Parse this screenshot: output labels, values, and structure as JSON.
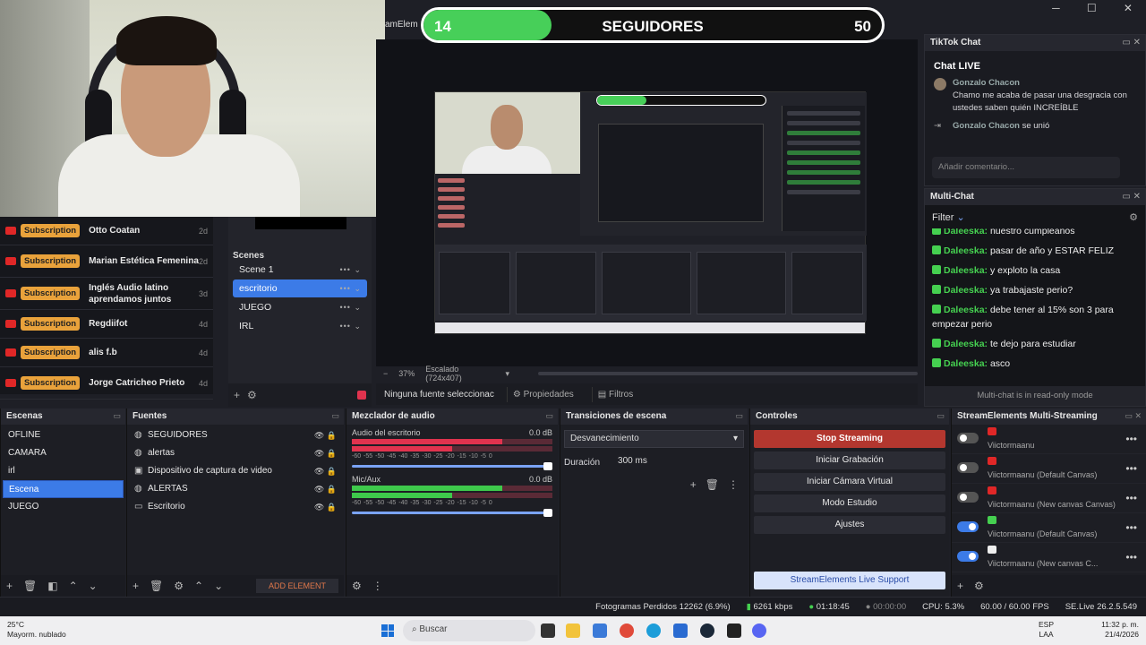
{
  "banner": {
    "current": "14",
    "title": "SEGUIDORES",
    "goal": "50",
    "progress_fraction": 0.28
  },
  "menu_fragment": "amElem",
  "window_buttons": [
    "─",
    "☐",
    "✕"
  ],
  "events": [
    {
      "badge": "Subscription",
      "name": "Otto Coatan",
      "ago": "2d"
    },
    {
      "badge": "Subscription",
      "name": "Marian Estética Femenina",
      "ago": "2d"
    },
    {
      "badge": "Subscription",
      "name": "Inglés Audio latino aprendamos juntos",
      "ago": "3d"
    },
    {
      "badge": "Subscription",
      "name": "Regdiifot",
      "ago": "4d"
    },
    {
      "badge": "Subscription",
      "name": "alis f.b",
      "ago": "4d"
    },
    {
      "badge": "Subscription",
      "name": "Jorge Catricheo Prieto",
      "ago": "4d"
    }
  ],
  "mini_scenes": {
    "header": "Scenes",
    "items": [
      {
        "label": "Scene 1",
        "selected": false
      },
      {
        "label": "escritorio",
        "selected": true
      },
      {
        "label": "JUEGO",
        "selected": false
      },
      {
        "label": "IRL",
        "selected": false
      }
    ]
  },
  "preview_info": {
    "zoom": "37%",
    "scale": "Escalado (724x407)"
  },
  "source_bar": {
    "no_source": "Ninguna fuente seleccionac",
    "properties": "Propiedades",
    "filters": "Filtros"
  },
  "tiktok": {
    "title": "TikTok Chat",
    "live_label": "Chat LIVE",
    "messages": [
      {
        "user": "Gonzalo Chacon",
        "text": "Chamo me acaba de pasar una desgracia con ustedes saben quién INCREÍBLE"
      },
      {
        "user": "Gonzalo Chacon",
        "text": "se unió"
      }
    ],
    "input_placeholder": "Añadir comentario..."
  },
  "multichat": {
    "title": "Multi-Chat",
    "filter_label": "Filter",
    "messages": [
      {
        "user": "Daleeska:",
        "text": "nuestro cumpleanos"
      },
      {
        "user": "Daleeska:",
        "text": "pasar de año y ESTAR FELIZ"
      },
      {
        "user": "Daleeska:",
        "text": "y exploto la casa"
      },
      {
        "user": "Daleeska:",
        "text": "ya trabajaste perio?"
      },
      {
        "user": "Daleeska:",
        "text": "debe tener al 15% son 3 para empezar perio"
      },
      {
        "user": "Daleeska:",
        "text": "te dejo para estudiar"
      },
      {
        "user": "Daleeska:",
        "text": "asco"
      }
    ],
    "readonly_note": "Multi-chat is in read-only mode"
  },
  "docks": {
    "escenas": {
      "title": "Escenas",
      "items": [
        "OFLINE",
        "CAMARA",
        "irl",
        "Escena",
        "JUEGO"
      ],
      "selected_index": 3
    },
    "fuentes": {
      "title": "Fuentes",
      "items": [
        {
          "icon": "globe-icon",
          "label": "SEGUIDORES"
        },
        {
          "icon": "globe-icon",
          "label": "alertas"
        },
        {
          "icon": "camera-icon",
          "label": "Dispositivo de captura de video"
        },
        {
          "icon": "globe-icon",
          "label": "ALERTAS"
        },
        {
          "icon": "monitor-icon",
          "label": "Escritorio"
        }
      ],
      "add_element": "ADD ELEMENT"
    },
    "mezclador": {
      "title": "Mezclador de audio",
      "tracks": [
        {
          "name": "Audio del escritorio",
          "db": "0.0 dB",
          "scale": "-60 -55 -50 -45 -40 -35 -30 -25 -20 -15 -10 -5 0",
          "color": "#e0334e"
        },
        {
          "name": "Mic/Aux",
          "db": "0.0 dB",
          "scale": "-60 -55 -50 -45 -40 -35 -30 -25 -20 -15 -10 -5 0",
          "color": "#3ec94b"
        }
      ]
    },
    "transiciones": {
      "title": "Transiciones de escena",
      "selected": "Desvanecimiento",
      "duration_label": "Duración",
      "duration_value": "300 ms"
    },
    "controles": {
      "title": "Controles",
      "buttons": [
        "Stop Streaming",
        "Iniciar Grabación",
        "Iniciar Cámara Virtual",
        "Modo Estudio",
        "Ajustes"
      ],
      "support": "StreamElements Live Support"
    },
    "multistream": {
      "title": "StreamElements Multi-Streaming",
      "items": [
        {
          "on": false,
          "platform": "youtube",
          "name": "Viictormaanu"
        },
        {
          "on": false,
          "platform": "youtube",
          "name": "Viictormaanu (Default Canvas)"
        },
        {
          "on": false,
          "platform": "youtube",
          "name": "Viictormaanu (New canvas Canvas)"
        },
        {
          "on": true,
          "platform": "kick",
          "name": "Viictormaanu (Default Canvas)"
        },
        {
          "on": true,
          "platform": "tiktok",
          "name": "Viictormaanu (New canvas C..."
        }
      ]
    }
  },
  "status": {
    "dropped": "Fotogramas Perdidos 12262 (6.9%)",
    "kbps": "6261 kbps",
    "stream_time": "01:18:45",
    "rec_time": "00:00:00",
    "cpu": "CPU: 5.3%",
    "fps": "60.00 / 60.00 FPS",
    "version": "SE.Live 26.2.5.549"
  },
  "taskbar": {
    "temp": "25°C",
    "weather": "Mayorm. nublado",
    "search": "Buscar",
    "lang1": "ESP",
    "lang2": "LAA",
    "time": "11:32 p. m.",
    "date": "21/4/2026"
  }
}
